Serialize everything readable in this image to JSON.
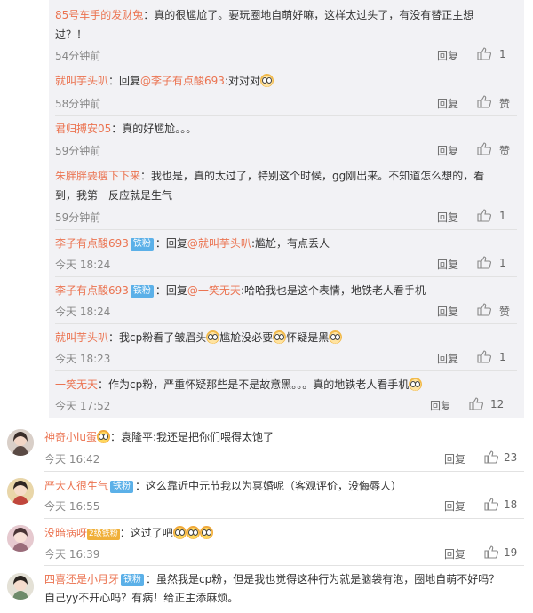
{
  "sub_comments": [
    {
      "name": "85号车手的发财兔",
      "text": "：真的很尴尬了。要玩圈地自萌好嘛，这样太过头了，有没有替正主想",
      "text2": "过？！",
      "time": "54分钟前",
      "reply": "回复",
      "likes": "1"
    },
    {
      "name": "就叫芋头叭",
      "text_pre": "：回复",
      "at": "@李子有点酸693",
      "text": ":对对对",
      "time": "58分钟前",
      "reply": "回复",
      "likes": "赞"
    },
    {
      "name": "君归搏安05",
      "text": "：真的好尴尬。。。",
      "time": "59分钟前",
      "reply": "回复",
      "likes": "赞"
    },
    {
      "name": "朱胖胖要瘦下下来",
      "text": "：我也是，真的太过了，特别这个时候，gg刚出来。不知道怎么想的，看",
      "text2": "到，我第一反应就是生气",
      "time": "59分钟前",
      "reply": "回复",
      "likes": "1"
    },
    {
      "name": "李子有点酸693",
      "badge": "铁粉",
      "text_pre": "：回复",
      "at": "@就叫芋头叭",
      "text": ":尴尬，有点丢人",
      "time": "今天 18:24",
      "reply": "回复",
      "likes": "1"
    },
    {
      "name": "李子有点酸693",
      "badge": "铁粉",
      "text_pre": "：回复",
      "at": "@一笑无天",
      "text": ":哈哈我也是这个表情，地铁老人看手机",
      "time": "今天 18:24",
      "reply": "回复",
      "likes": "赞"
    },
    {
      "name": "就叫芋头叭",
      "text": "：我cp粉看了皱眉头",
      "text_b": "尴尬没必要",
      "text_c": "怀疑是黑",
      "time": "今天 18:23",
      "reply": "回复",
      "likes": "1"
    },
    {
      "name": "一笑无天",
      "text": "：作为cp粉，严重怀疑那些是不是故意黑。。。真的地铁老人看手机",
      "time": "今天 17:52",
      "reply": "回复",
      "likes": "12"
    }
  ],
  "top_comments": [
    {
      "name": "神奇小lu蛋",
      "text": "：袁隆平:我还是把你们喂得太饱了",
      "time": "今天 16:42",
      "reply": "回复",
      "likes": "23"
    },
    {
      "name": "严大人很生气",
      "badge": "铁粉",
      "text": "：这么靠近中元节我以为冥婚呢（客观评价，没侮辱人）",
      "time": "今天 16:55",
      "reply": "回复",
      "likes": "18"
    },
    {
      "name": "没暗病呀",
      "vip": "2级铁粉",
      "text": "：这过了吧",
      "time": "今天 16:39",
      "reply": "回复",
      "likes": "19"
    },
    {
      "name": "四喜还是小月牙",
      "badge": "铁粉",
      "text": "：虽然我是cp粉，但是我也觉得这种行为就是脑袋有泡，圈地自萌不好吗？",
      "text2": "自己yy不开心吗？有病！给正主添麻烦。"
    }
  ]
}
